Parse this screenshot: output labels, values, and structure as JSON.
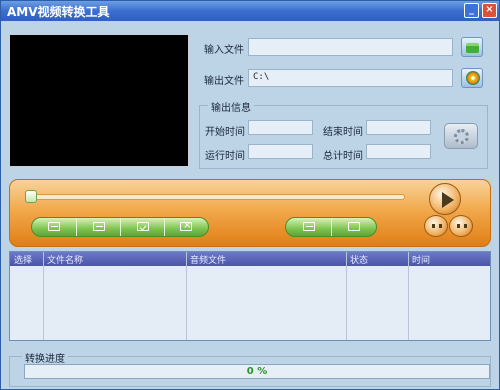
{
  "window": {
    "title": "AMV视频转换工具",
    "min_glyph": "_",
    "close_glyph": "×"
  },
  "files": {
    "input_label": "输入文件",
    "input_value": "",
    "output_label": "输出文件",
    "output_value": "C:\\"
  },
  "output_info": {
    "group_title": "输出信息",
    "start_time_label": "开始时间",
    "start_time_value": "",
    "end_time_label": "结束时间",
    "end_time_value": "",
    "run_time_label": "运行时间",
    "run_time_value": "",
    "total_time_label": "总计时间",
    "total_time_value": ""
  },
  "player": {
    "position_fraction": 0.0
  },
  "list": {
    "columns": [
      "选择",
      "文件名称",
      "音频文件",
      "状态",
      "时间"
    ],
    "rows": []
  },
  "progress": {
    "title": "转换进度",
    "value_text": "0 %",
    "fraction": 0.0
  },
  "colors": {
    "accent_orange": "#f2a94c",
    "green": "#7ec44f",
    "header_blue": "#4a54a8"
  }
}
